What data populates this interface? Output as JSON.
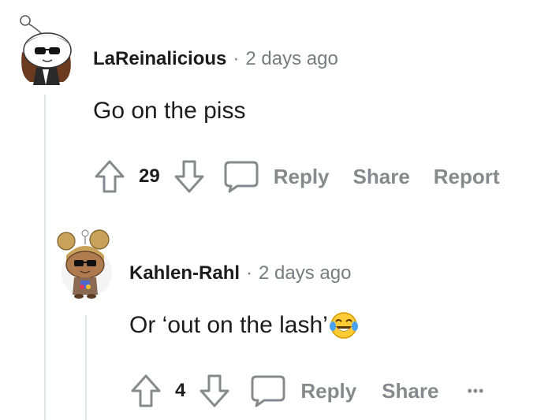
{
  "comments": [
    {
      "author": "LaReinalicious",
      "separator": "·",
      "time": "2 days ago",
      "body": "Go on the piss",
      "score": "29",
      "reply_label": "Reply",
      "share_label": "Share",
      "report_label": "Report",
      "avatar_icon": "snoo-avatar-sunglasses-bandana-icon"
    },
    {
      "author": "Kahlen-Rahl",
      "separator": "·",
      "time": "2 days ago",
      "body": "Or ‘out on the lash’",
      "emoji_icon": "face-with-tears-of-joy-icon",
      "score": "4",
      "reply_label": "Reply",
      "share_label": "Share",
      "more_label": "•••",
      "avatar_icon": "snoo-avatar-space-buns-sunglasses-icon"
    }
  ],
  "colors": {
    "author": "#1c1c1c",
    "meta": "#787c7e",
    "action": "#878a8c",
    "thread_line": "#e3e6e8"
  }
}
